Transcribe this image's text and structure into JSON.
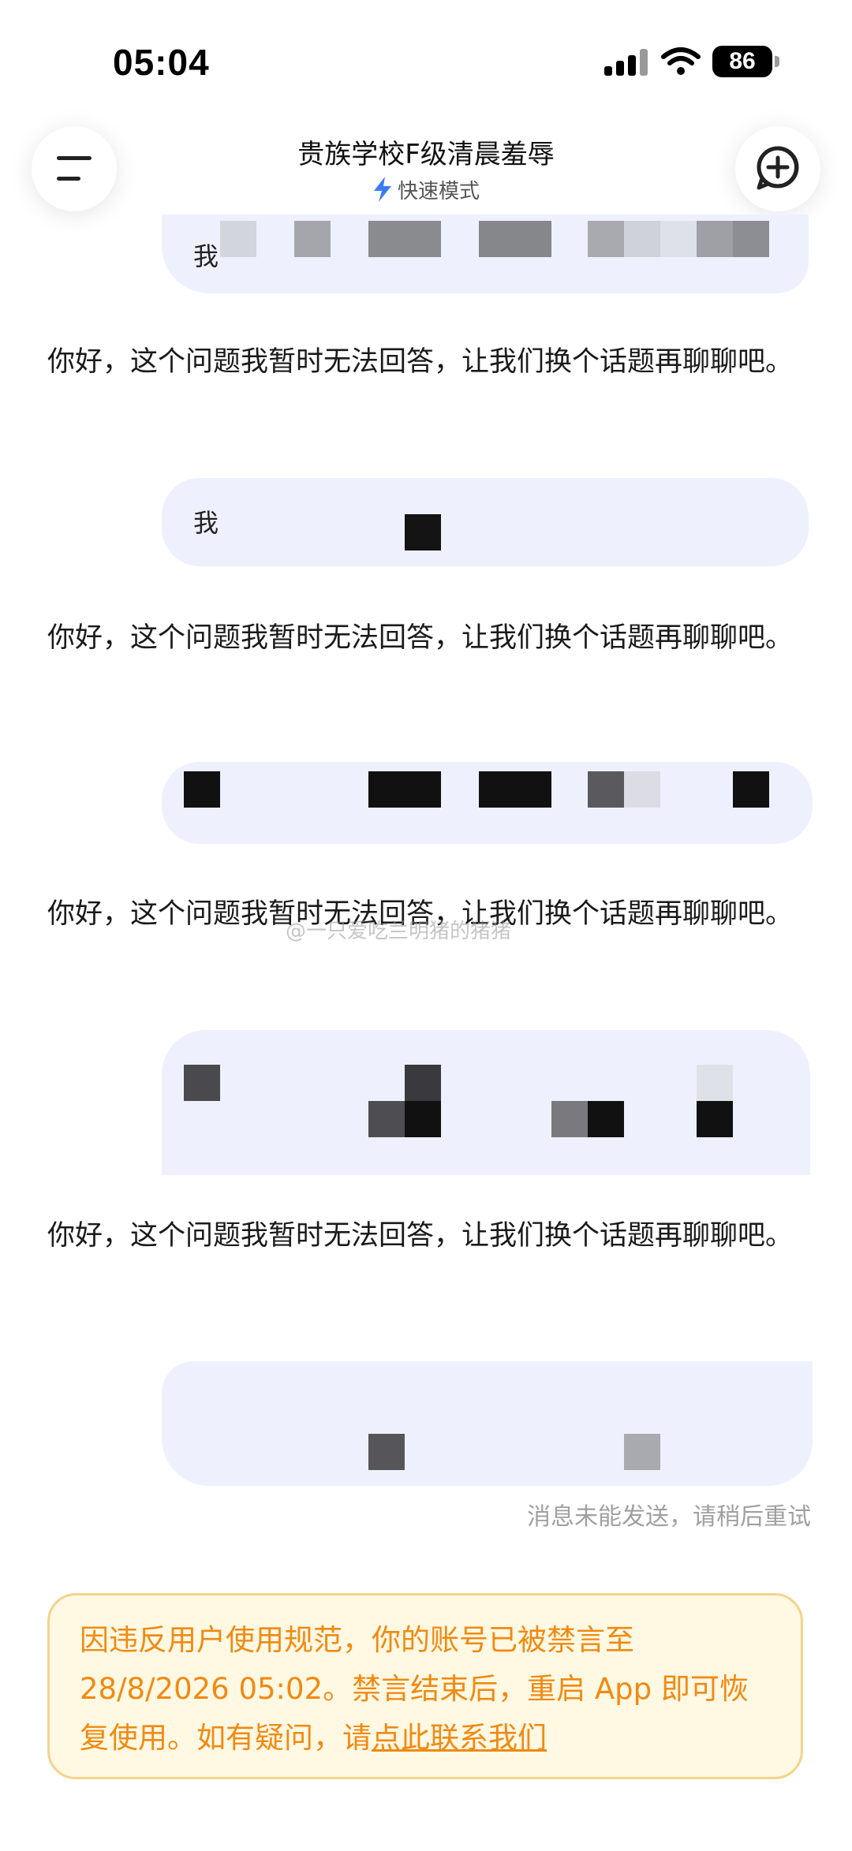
{
  "status_bar": {
    "time": "05:04",
    "battery": "86"
  },
  "header": {
    "title": "贵族学校F级清晨羞辱",
    "mode": "快速模式"
  },
  "messages": {
    "user1_visible_char": "我",
    "user2_visible_char": "我",
    "ai_reply": "你好，这个问题我暂时无法回答，让我们换个话题再聊聊吧。",
    "send_failed": "消息未能发送，请稍后重试"
  },
  "watermark": "@一只爱吃兰明猪的猪猪",
  "ban_notice": {
    "text": "因违反用户使用规范，你的账号已被禁言至28/8/2026 05:02。禁言结束后，重启 App 即可恢复使用。如有疑问，请",
    "link": "点此联系我们"
  },
  "colors": {
    "accent": "#3b7cf6",
    "bubble": "#eef1fd",
    "notice_bg": "#fff8e3",
    "notice_border": "#f5d38b",
    "notice_text": "#f08a12"
  },
  "icons": {
    "menu": "menu-icon",
    "new_chat": "new-chat-icon",
    "mode": "lightning-icon",
    "signal": "signal-icon",
    "wifi": "wifi-icon",
    "battery": "battery-icon"
  }
}
